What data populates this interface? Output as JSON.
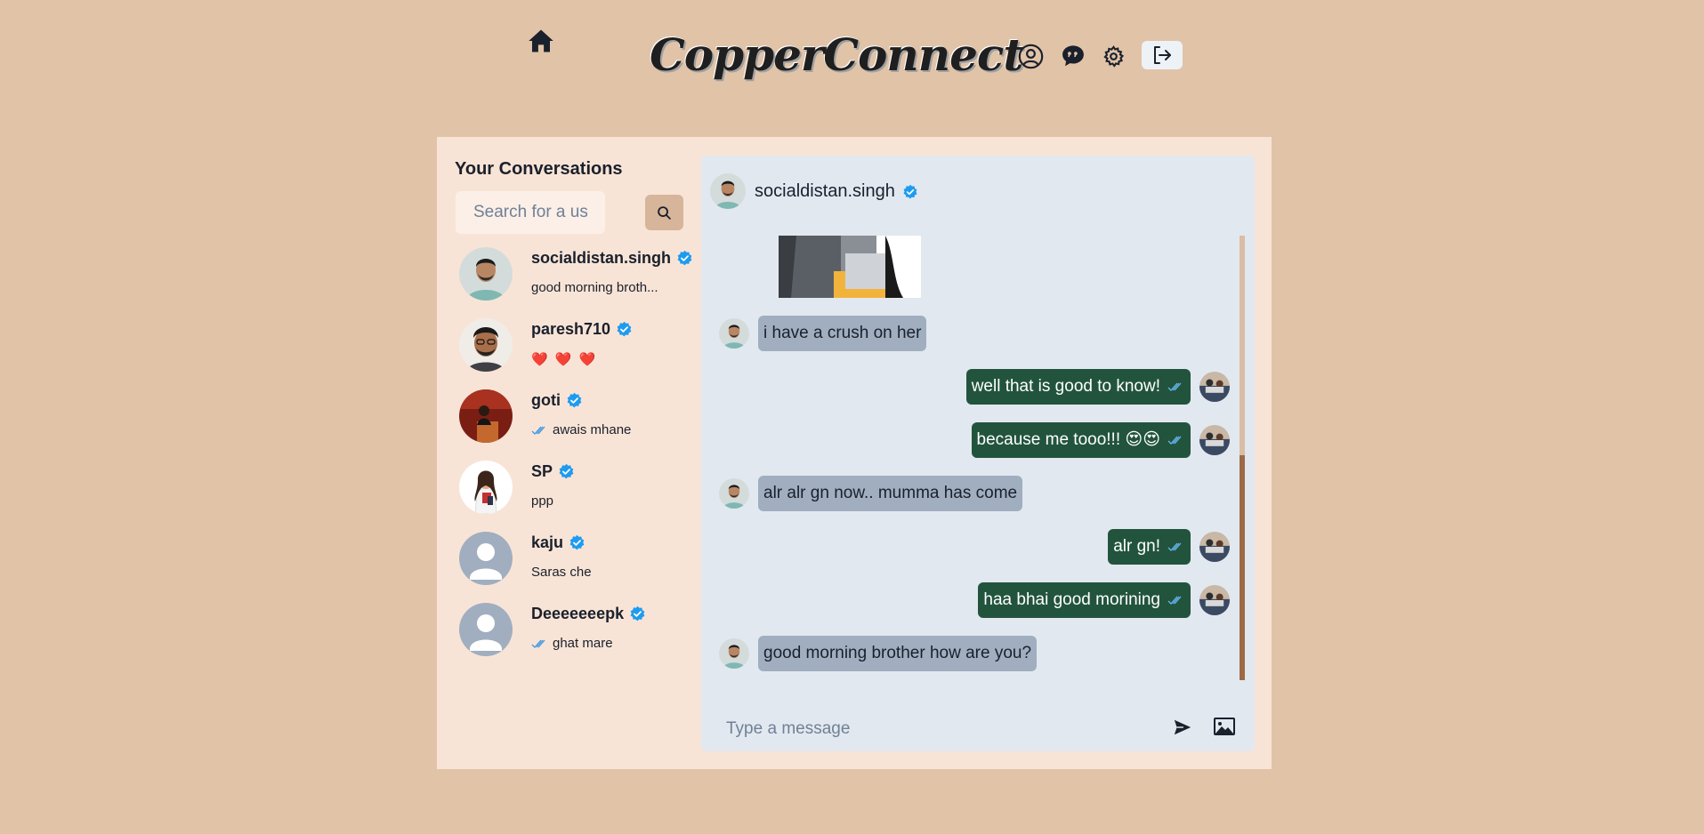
{
  "app": {
    "logo_text": "CopperConnect"
  },
  "header": {
    "icons": [
      "home-icon",
      "profile-icon",
      "chat-icon",
      "settings-icon",
      "logout-icon"
    ]
  },
  "sidebar": {
    "title": "Your Conversations",
    "search_placeholder": "Search for a user",
    "conversations": [
      {
        "name": "socialdistan.singh",
        "verified": true,
        "last": "good morning broth...",
        "seen": false,
        "avatar": "photo-man-teal"
      },
      {
        "name": "paresh710",
        "verified": true,
        "last": "❤️ ❤️ ❤️",
        "seen": false,
        "avatar": "photo-man-glasses"
      },
      {
        "name": "goti",
        "verified": true,
        "last": "awais mhane",
        "seen": true,
        "avatar": "photo-red-room"
      },
      {
        "name": "SP",
        "verified": true,
        "last": "ppp",
        "seen": false,
        "avatar": "photo-woman"
      },
      {
        "name": "kaju",
        "verified": true,
        "last": "Saras che",
        "seen": false,
        "avatar": "default-avatar"
      },
      {
        "name": "Deeeeeeepk",
        "verified": true,
        "last": "ghat mare",
        "seen": true,
        "avatar": "default-avatar"
      }
    ]
  },
  "chat": {
    "partner": "socialdistan.singh",
    "verified": true,
    "messages": [
      {
        "dir": "in",
        "text": "i have a crush on her"
      },
      {
        "dir": "out",
        "text": "well that is good to know!",
        "seen": true
      },
      {
        "dir": "out",
        "text": "because me tooo!!! 😍😍",
        "seen": true
      },
      {
        "dir": "in",
        "text": "alr alr gn now.. mumma has come"
      },
      {
        "dir": "out",
        "text": "alr gn!",
        "seen": true
      },
      {
        "dir": "out",
        "text": "haa bhai good morining",
        "seen": true
      },
      {
        "dir": "in",
        "text": "good morning brother how are you?"
      }
    ],
    "input_placeholder": "Type a message"
  },
  "colors": {
    "page_bg": "#e1c3a8",
    "panel_bg": "#f8e4d6",
    "chat_bg": "#e2e8f0",
    "incoming_bubble": "#a0aec0",
    "outgoing_bubble": "#22543d",
    "verified_blue": "#1d9bf0",
    "seen_blue": "#4299e1"
  }
}
